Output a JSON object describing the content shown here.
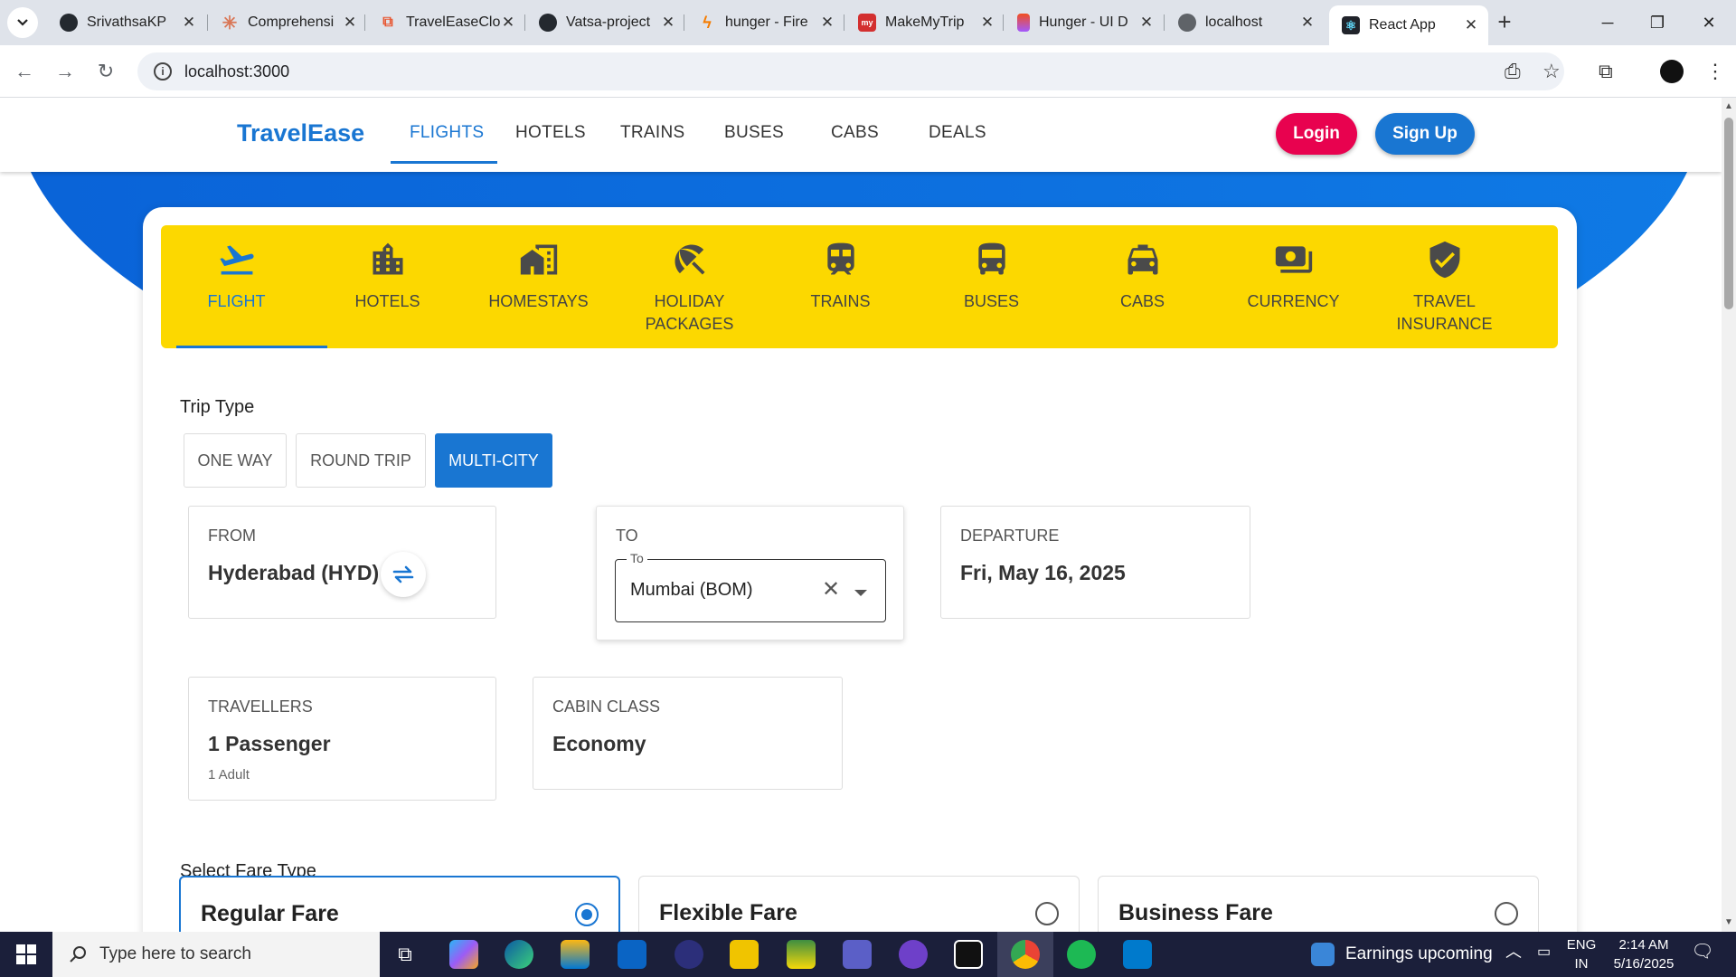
{
  "browser": {
    "tabs": [
      {
        "title": "SrivathsaKP",
        "favicon": "github-icon",
        "color": "#24292f"
      },
      {
        "title": "Comprehensi",
        "favicon": "claude-icon",
        "color": "#d97757"
      },
      {
        "title": "TravelEaseClo",
        "favicon": "app-icon",
        "color": "#e8552f"
      },
      {
        "title": "Vatsa-project",
        "favicon": "github-icon",
        "color": "#24292f"
      },
      {
        "title": "hunger - Fire",
        "favicon": "firebase-icon",
        "color": "#f57c00"
      },
      {
        "title": "MakeMyTrip",
        "favicon": "makemytrip-icon",
        "color": "#d32f2f"
      },
      {
        "title": "Hunger - UI D",
        "favicon": "figma-icon",
        "color": "#f24e1e"
      },
      {
        "title": "localhost",
        "favicon": "globe-icon",
        "color": "#5f6368"
      },
      {
        "title": "React App",
        "favicon": "react-icon",
        "color": "#20232a"
      }
    ],
    "url": "localhost:3000"
  },
  "header": {
    "logo": "TravelEase",
    "nav": [
      "FLIGHTS",
      "HOTELS",
      "TRAINS",
      "BUSES",
      "CABS",
      "DEALS"
    ],
    "active_nav": "FLIGHTS",
    "login": "Login",
    "signup": "Sign Up"
  },
  "categories": [
    {
      "label": "FLIGHT",
      "icon": "flight-takeoff-icon",
      "active": true
    },
    {
      "label": "HOTELS",
      "icon": "hotel-building-icon"
    },
    {
      "label": "HOMESTAYS",
      "icon": "homestay-icon"
    },
    {
      "label": "HOLIDAY PACKAGES",
      "icon": "beach-umbrella-icon"
    },
    {
      "label": "TRAINS",
      "icon": "train-icon"
    },
    {
      "label": "BUSES",
      "icon": "bus-icon"
    },
    {
      "label": "CABS",
      "icon": "cab-icon"
    },
    {
      "label": "CURRENCY",
      "icon": "currency-icon"
    },
    {
      "label": "TRAVEL INSURANCE",
      "icon": "shield-check-icon"
    }
  ],
  "trip": {
    "title": "Trip Type",
    "options": [
      "ONE WAY",
      "ROUND TRIP",
      "MULTI-CITY"
    ],
    "selected": "MULTI-CITY"
  },
  "from": {
    "label": "FROM",
    "value": "Hyderabad (HYD)"
  },
  "to": {
    "label": "TO",
    "legend": "To",
    "value": "Mumbai (BOM)"
  },
  "departure": {
    "label": "DEPARTURE",
    "value": "Fri, May 16, 2025"
  },
  "travellers": {
    "label": "TRAVELLERS",
    "value": "1 Passenger",
    "sub": "1 Adult"
  },
  "cabin": {
    "label": "CABIN CLASS",
    "value": "Economy"
  },
  "fare": {
    "title": "Select Fare Type",
    "options": [
      "Regular Fare",
      "Flexible Fare",
      "Business Fare"
    ],
    "selected": "Regular Fare"
  },
  "taskbar": {
    "search_placeholder": "Type here to search",
    "news": "Earnings upcoming",
    "lang": "ENG",
    "region": "IN",
    "time": "2:14 AM",
    "date": "5/16/2025"
  },
  "colors": {
    "brand": "#1976d2",
    "category_bar": "#fcd800",
    "login": "#e8024f"
  }
}
